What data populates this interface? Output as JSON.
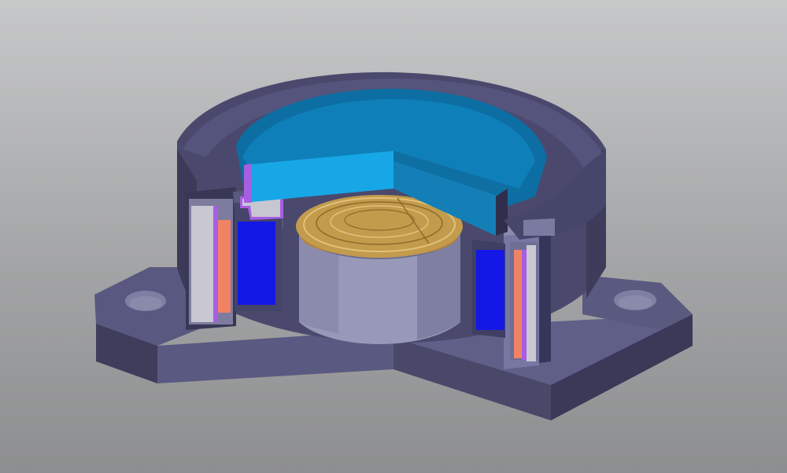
{
  "viewport": {
    "background_top": "#c7c8c9",
    "background_bottom": "#8d8e8f"
  },
  "model": {
    "type": "cutaway 3D CAD model",
    "parts": [
      {
        "name": "flange-base",
        "color": "#3e3d5c"
      },
      {
        "name": "housing-ring",
        "color": "#4b4a6e"
      },
      {
        "name": "membrane-plate",
        "color": "#0f7fb9"
      },
      {
        "name": "coil-pad",
        "color": "#f18266"
      },
      {
        "name": "magnet-block",
        "color": "#1418e6"
      },
      {
        "name": "pole-piece",
        "color": "#9899b8"
      },
      {
        "name": "brass-diaphragm",
        "color": "#b88d3c"
      },
      {
        "name": "liner",
        "color": "#a85ee3"
      }
    ]
  }
}
